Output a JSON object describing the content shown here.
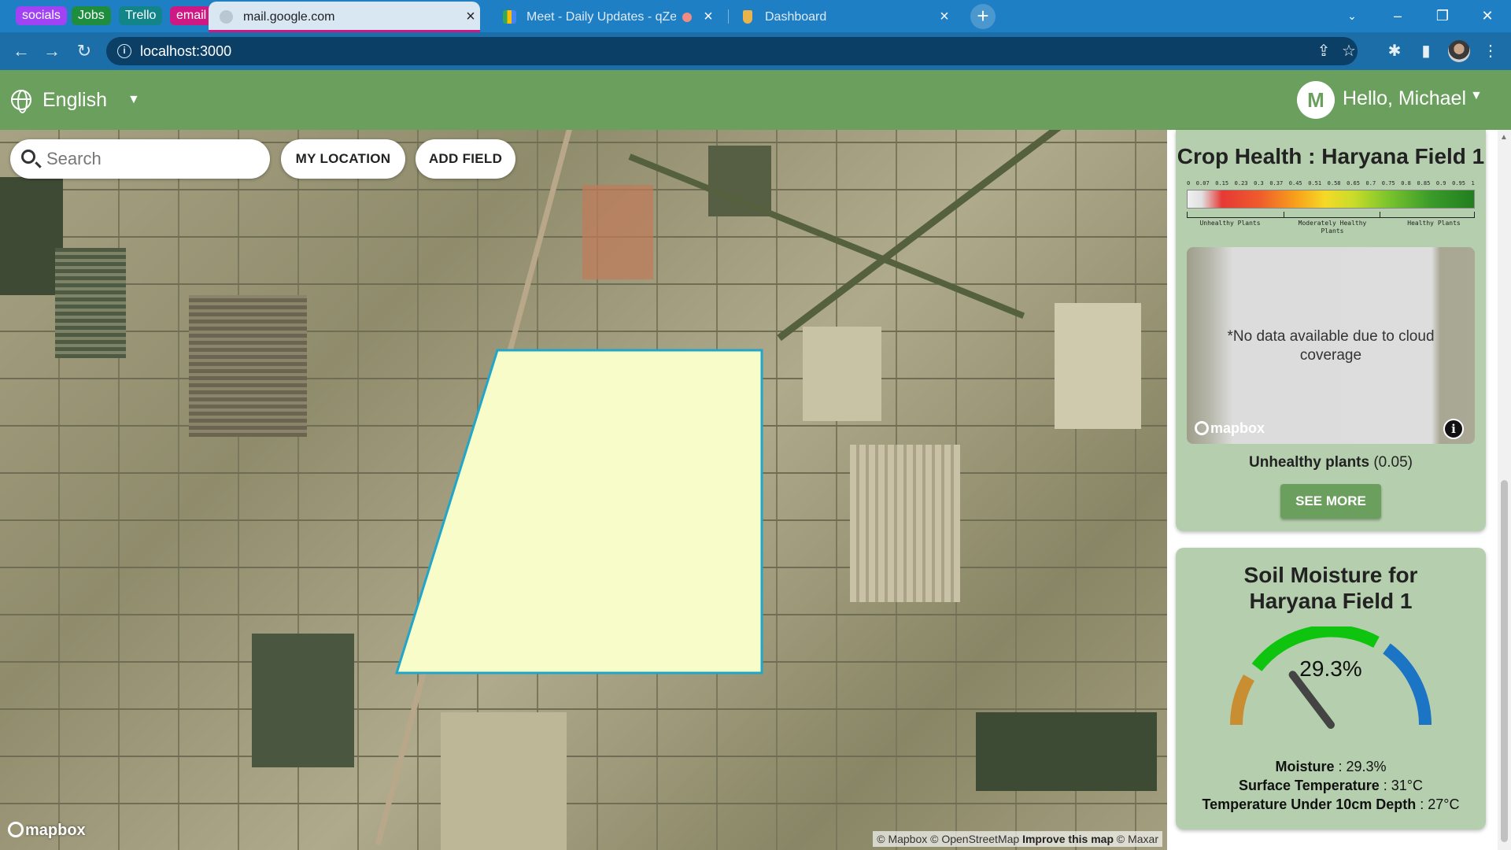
{
  "browser": {
    "tab_groups": [
      {
        "label": "socials",
        "color": "#a142f4"
      },
      {
        "label": "Jobs",
        "color": "#1e8e3e"
      },
      {
        "label": "Trello",
        "color": "#12858a"
      },
      {
        "label": "email",
        "color": "#d01884"
      }
    ],
    "tabs": [
      {
        "title": "mail.google.com",
        "active": true
      },
      {
        "title": "Meet - Daily Updates - qZen",
        "active": false
      },
      {
        "title": "Dashboard",
        "active": false
      }
    ],
    "url": "localhost:3000"
  },
  "header": {
    "language": "English",
    "avatar_initial": "M",
    "greeting": "Hello, Michael"
  },
  "map": {
    "search_placeholder": "Search",
    "my_location_label": "MY LOCATION",
    "add_field_label": "ADD FIELD",
    "logo_text": "mapbox",
    "attribution_1": "© Mapbox © OpenStreetMap",
    "attribution_improve": "Improve this map",
    "attribution_2": "© Maxar"
  },
  "crop_health": {
    "title": "Crop Health : Haryana Field 1",
    "legend_ticks": [
      "0",
      "0.07",
      "0.15",
      "0.23",
      "0.3",
      "0.37",
      "0.45",
      "0.51",
      "0.58",
      "0.65",
      "0.7",
      "0.75",
      "0.8",
      "0.85",
      "0.9",
      "0.95",
      "1"
    ],
    "legend_labels": [
      "Unhealthy Plants",
      "Moderately Healthy Plants",
      "Healthy Plants"
    ],
    "no_data_text": "*No data available due to cloud coverage",
    "logo_text": "mapbox",
    "status_label": "Unhealthy plants",
    "status_value": "(0.05)",
    "see_more_label": "SEE MORE"
  },
  "soil_moisture": {
    "title": "Soil Moisture for Haryana Field 1",
    "gauge_value": "29.3%",
    "gauge_fraction": 0.293,
    "moisture_label": "Moisture",
    "moisture_value": "29.3%",
    "surface_temp_label": "Surface Temperature",
    "surface_temp_value": "31°C",
    "depth_temp_label": "Temperature Under 10cm Depth",
    "depth_temp_value": "27°C",
    "colors": {
      "dry": "#c98d32",
      "ideal": "#0ec40e",
      "wet": "#1b74c4",
      "needle": "#444444"
    }
  },
  "colors": {
    "primary": "#6b9f5e",
    "card_bg": "#b5cfae",
    "field_fill": "#f7fcc8",
    "field_stroke": "#1fa6c9"
  }
}
